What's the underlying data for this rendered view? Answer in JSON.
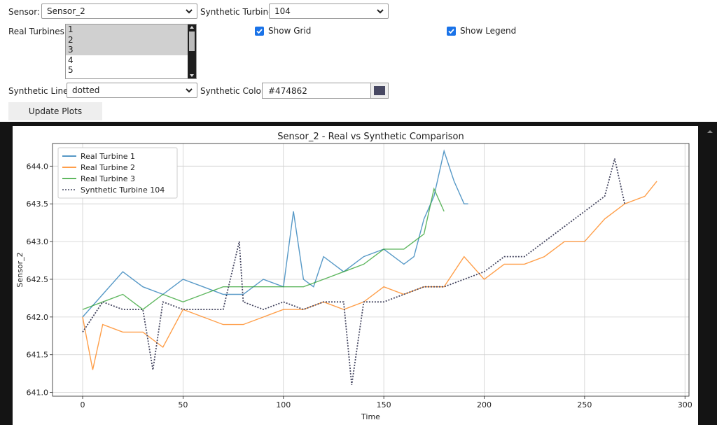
{
  "controls": {
    "sensor_label": "Sensor:",
    "sensor_value": "Sensor_2",
    "synthetic_turbine_label": "Synthetic Turbine:",
    "synthetic_turbine_value": "104",
    "real_turbines_label": "Real Turbines:",
    "real_turbines_options": [
      {
        "label": "1",
        "selected": true
      },
      {
        "label": "2",
        "selected": true
      },
      {
        "label": "3",
        "selected": true
      },
      {
        "label": "4",
        "selected": false
      },
      {
        "label": "5",
        "selected": false
      }
    ],
    "show_grid_label": "Show Grid",
    "show_grid_checked": true,
    "show_legend_label": "Show Legend",
    "show_legend_checked": true,
    "synthetic_line_label": "Synthetic Line:",
    "synthetic_line_value": "dotted",
    "synthetic_color_label": "Synthetic Color:",
    "synthetic_color_value": "#474862",
    "update_button_label": "Update Plots",
    "icons": {
      "dropdown": "chevron-down-icon",
      "checkbox": "checkmark-icon"
    },
    "accent_color": "#1a73e8"
  },
  "chart_data": {
    "type": "line",
    "title": "Sensor_2 - Real vs Synthetic Comparison",
    "xlabel": "Time",
    "ylabel": "Sensor_2",
    "xlim": [
      -15,
      302
    ],
    "ylim": [
      640.95,
      644.3
    ],
    "xticks": [
      0,
      50,
      100,
      150,
      200,
      250,
      300
    ],
    "yticks": [
      641.0,
      641.5,
      642.0,
      642.5,
      643.0,
      643.5,
      644.0
    ],
    "grid": true,
    "legend": "top-left",
    "series": [
      {
        "name": "Real Turbine 1",
        "color": "#1f77b4",
        "style": "solid",
        "x": [
          0,
          10,
          20,
          30,
          40,
          50,
          60,
          70,
          80,
          90,
          100,
          105,
          110,
          115,
          120,
          130,
          140,
          150,
          160,
          165,
          170,
          175,
          180,
          185,
          190,
          192
        ],
        "y": [
          642.0,
          642.3,
          642.6,
          642.4,
          642.3,
          642.5,
          642.4,
          642.3,
          642.3,
          642.5,
          642.4,
          643.4,
          642.5,
          642.4,
          642.8,
          642.6,
          642.8,
          642.9,
          642.7,
          642.8,
          643.3,
          643.6,
          644.2,
          643.8,
          643.5,
          643.5
        ]
      },
      {
        "name": "Real Turbine 2",
        "color": "#ff7f0e",
        "style": "solid",
        "x": [
          0,
          5,
          10,
          20,
          30,
          40,
          50,
          60,
          70,
          80,
          90,
          100,
          110,
          120,
          130,
          140,
          150,
          160,
          170,
          180,
          190,
          200,
          210,
          220,
          230,
          240,
          250,
          260,
          270,
          280,
          286
        ],
        "y": [
          642.0,
          641.3,
          641.9,
          641.8,
          641.8,
          641.6,
          642.1,
          642.0,
          641.9,
          641.9,
          642.0,
          642.1,
          642.1,
          642.2,
          642.1,
          642.2,
          642.4,
          642.3,
          642.4,
          642.4,
          642.8,
          642.5,
          642.7,
          642.7,
          642.8,
          643.0,
          643.0,
          643.3,
          643.5,
          643.6,
          643.8
        ]
      },
      {
        "name": "Real Turbine 3",
        "color": "#2ca02c",
        "style": "solid",
        "x": [
          0,
          10,
          20,
          30,
          40,
          50,
          60,
          70,
          80,
          90,
          100,
          110,
          120,
          130,
          140,
          150,
          160,
          170,
          175,
          180
        ],
        "y": [
          642.1,
          642.2,
          642.3,
          642.1,
          642.3,
          642.2,
          642.3,
          642.4,
          642.4,
          642.4,
          642.4,
          642.4,
          642.5,
          642.6,
          642.7,
          642.9,
          642.9,
          643.1,
          643.7,
          643.4
        ]
      },
      {
        "name": "Synthetic Turbine 104",
        "color": "#474862",
        "style": "dotted",
        "x": [
          0,
          10,
          20,
          30,
          35,
          40,
          50,
          60,
          70,
          78,
          80,
          90,
          100,
          110,
          120,
          130,
          134,
          140,
          150,
          160,
          170,
          180,
          190,
          200,
          210,
          220,
          230,
          240,
          250,
          260,
          265,
          270
        ],
        "y": [
          641.8,
          642.2,
          642.1,
          642.1,
          641.3,
          642.2,
          642.1,
          642.1,
          642.1,
          643.0,
          642.2,
          642.1,
          642.2,
          642.1,
          642.2,
          642.2,
          641.1,
          642.2,
          642.2,
          642.3,
          642.4,
          642.4,
          642.5,
          642.6,
          642.8,
          642.8,
          643.0,
          643.2,
          643.4,
          643.6,
          644.1,
          643.5
        ]
      }
    ]
  }
}
